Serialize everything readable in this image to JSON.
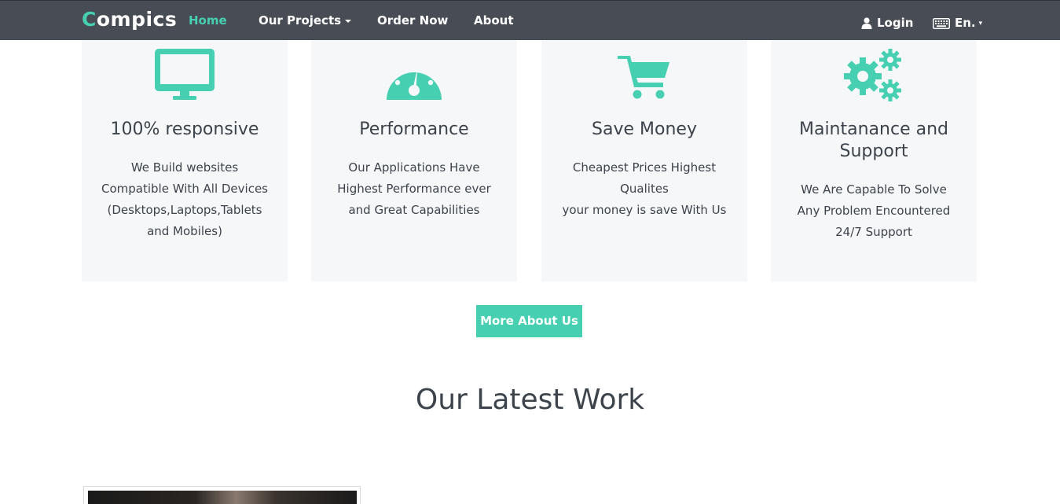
{
  "navbar": {
    "brand_first": "C",
    "brand_rest": "ompics",
    "links": [
      {
        "label": "Home",
        "active": true
      },
      {
        "label": "Our Projects",
        "dropdown": true
      },
      {
        "label": "Order Now"
      },
      {
        "label": "About"
      }
    ],
    "login_label": "Login",
    "language_label": "En.",
    "language_caret": "▾"
  },
  "features": [
    {
      "icon": "monitor-icon",
      "title": "100% responsive",
      "lines": [
        "We Build websites",
        "Compatible With All Devices",
        "(Desktops,Laptops,Tablets",
        "and Mobiles)"
      ]
    },
    {
      "icon": "speedometer-icon",
      "title": "Performance",
      "lines": [
        "Our Applications Have",
        "Highest Performance ever",
        "and Great Capabilities"
      ]
    },
    {
      "icon": "shopping-cart-icon",
      "title": "Save Money",
      "lines": [
        "Cheapest Prices Highest",
        "Qualites",
        "your money is save With Us"
      ]
    },
    {
      "icon": "gears-icon",
      "title_line1": "Maintanance and",
      "title_line2": "Support",
      "lines": [
        "We Are Capable To Solve",
        "Any Problem Encountered",
        "24/7 Support"
      ]
    }
  ],
  "more_button": "More About Us",
  "latest_work_title": "Our Latest Work",
  "colors": {
    "accent": "#46cfb0",
    "navbar": "#484d55",
    "card_bg": "#f6f7f9",
    "text": "#3d434b"
  }
}
